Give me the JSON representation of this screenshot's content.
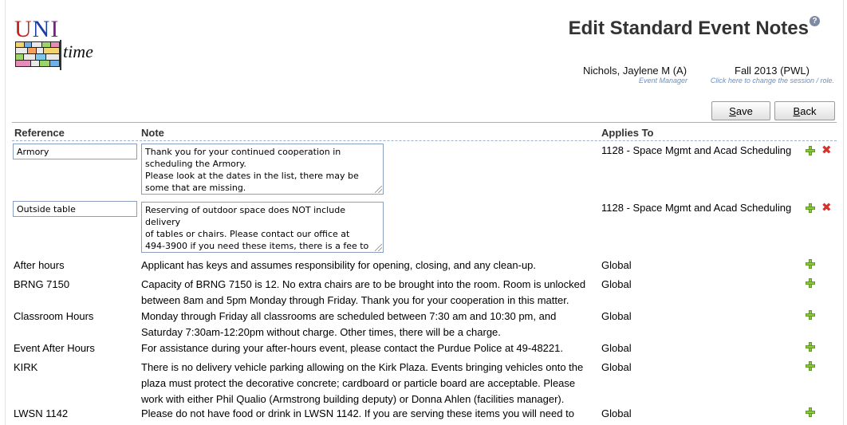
{
  "header": {
    "title": "Edit Standard Event Notes",
    "help_label": "?",
    "user_name": "Nichols, Jaylene M (A)",
    "user_role": "Event Manager",
    "session": "Fall 2013 (PWL)",
    "session_hint": "Click here to change the session / role."
  },
  "logo": {
    "uni_u": "U",
    "uni_n": "N",
    "uni_i": "I",
    "time": "time"
  },
  "buttons": {
    "save_first": "S",
    "save_rest": "ave",
    "back_first": "B",
    "back_rest": "ack"
  },
  "table": {
    "columns": {
      "reference": "Reference",
      "note": "Note",
      "applies_to": "Applies To"
    },
    "editing": [
      {
        "reference": "Armory",
        "note": "Thank you for your continued cooperation in\nscheduling the Armory.\nPlease look at the dates in the list, there may be\nsome that are missing.",
        "applies_to": "1128 - Space Mgmt and Acad Scheduling"
      },
      {
        "reference": "Outside table",
        "note": "Reserving of outdoor space does NOT include delivery\nof tables or chairs. Please contact our office at\n494-3900 if you need these items, there is a fee to\nhave them delivered.",
        "applies_to": "1128 - Space Mgmt and Acad Scheduling"
      }
    ],
    "rows": [
      {
        "reference": "After hours",
        "note": "Applicant has keys and assumes responsibility for opening, closing, and any clean-up.",
        "applies_to": "Global"
      },
      {
        "reference": "BRNG 7150",
        "note": "Capacity of BRNG 7150 is 12. No extra chairs are to be brought into the room. Room is unlocked between 8am and 5pm Monday through Friday. Thank you for your cooperation in this matter.",
        "applies_to": "Global"
      },
      {
        "reference": "Classroom Hours",
        "note": "Monday through Friday all classrooms are scheduled between 7:30 am and 10:30 pm, and Saturday 7:30am-12:20pm without charge. Other times, there will be a charge.",
        "applies_to": "Global"
      },
      {
        "reference": "Event After Hours",
        "note": "For assistance during your after-hours event, please contact the Purdue Police at 49-48221.",
        "applies_to": "Global"
      },
      {
        "reference": "KIRK",
        "note": "There is no delivery vehicle parking allowing on the Kirk Plaza. Events bringing vehicles onto the plaza must protect the decorative concrete; cardboard or particle board are acceptable. Please work with either Phil Qualio (Armstrong building deputy) or Donna Ahlen (facilities manager).",
        "applies_to": "Global"
      },
      {
        "reference": "LWSN 1142",
        "note": "Please do not have food or drink in LWSN 1142. If you are serving these items you will need to",
        "applies_to": "Global"
      }
    ]
  },
  "icons": {
    "add": "plus-icon",
    "delete": "cross-icon",
    "help": "help-icon"
  }
}
